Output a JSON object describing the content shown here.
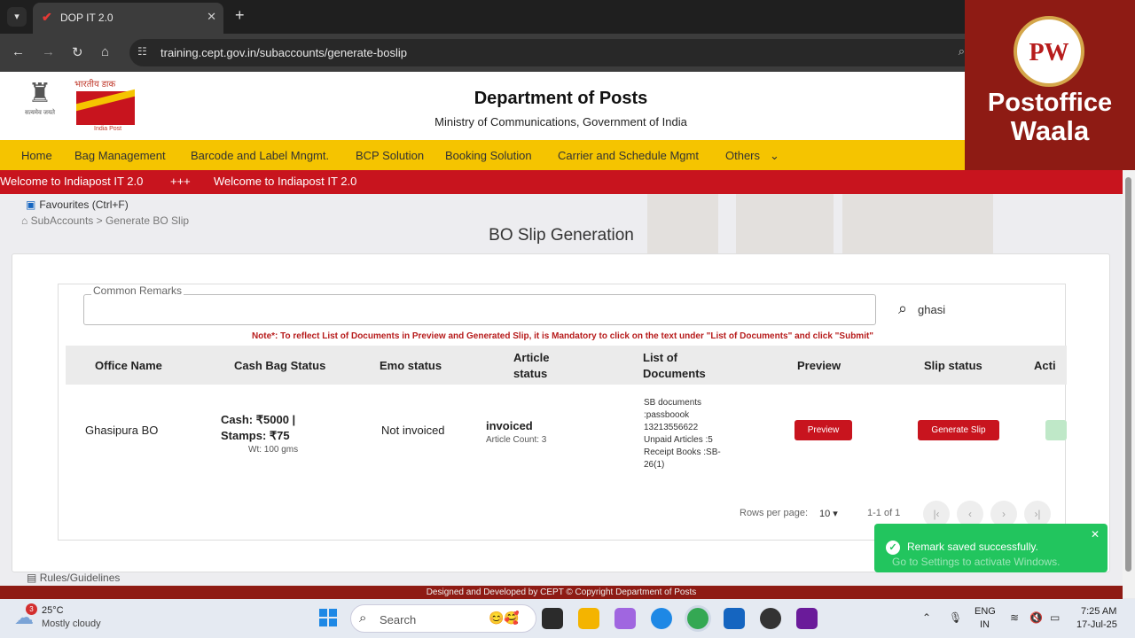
{
  "browser": {
    "tab_title": "DOP IT 2.0",
    "url": "training.cept.gov.in/subaccounts/generate-boslip"
  },
  "overlay": {
    "logo_text": "PW",
    "line1": "Postoffice",
    "line2": "Waala"
  },
  "header": {
    "title": "Department of Posts",
    "subtitle": "Ministry of Communications, Government of India",
    "emblem_caption": "सत्यमेव जयते",
    "logo_hindi": "भारतीय डाक",
    "logo_english": "India Post"
  },
  "nav": {
    "items": [
      "Home",
      "Bag Management",
      "Barcode and Label Mngmt.",
      "BCP Solution",
      "Booking Solution",
      "Carrier and Schedule Mgmt",
      "Others"
    ]
  },
  "ticker": {
    "msg1": "Welcome to Indiapost IT 2.0",
    "sep": "+++",
    "msg2": "Welcome to Indiapost IT 2.0"
  },
  "page": {
    "favourites": "Favourites (Ctrl+F)",
    "breadcrumb_root": "SubAccounts",
    "breadcrumb_sep": ">",
    "breadcrumb_current": "Generate BO Slip",
    "title": "BO Slip Generation",
    "remarks_label": "Common Remarks",
    "remarks_value": "",
    "search_value": "ghasi",
    "note": "Note*: To reflect List of Documents in Preview and Generated Slip, it is Mandatory to click on the text under \"List of Documents\" and click \"Submit\""
  },
  "table": {
    "headers": {
      "office": "Office Name",
      "cash": "Cash Bag Status",
      "emo": "Emo status",
      "article1": "Article",
      "article2": "status",
      "docs1": "List of",
      "docs2": "Documents",
      "preview": "Preview",
      "slip": "Slip status",
      "action": "Acti"
    },
    "row": {
      "office": "Ghasipura BO",
      "cash_line1": "Cash: ₹5000 |",
      "cash_line2": "Stamps: ₹75",
      "weight": "Wt: 100 gms",
      "emo": "Not invoiced",
      "article_status": "invoiced",
      "article_count": "Article Count: 3",
      "docs": [
        "SB documents",
        ":passboook",
        "13213556622",
        "Unpaid Articles :5",
        "Receipt Books :SB-",
        "26(1)"
      ],
      "preview_btn": "Preview",
      "slip_btn": "Generate Slip"
    }
  },
  "pager": {
    "rows_label": "Rows per page:",
    "rows_value": "10",
    "range": "1-1 of 1"
  },
  "rules": "Rules/Guidelines",
  "footer": "Designed and Developed by CEPT © Copyright Department of Posts",
  "toast": {
    "message": "Remark saved successfully.",
    "watermark": "Go to Settings to activate Windows."
  },
  "taskbar": {
    "weather_badge": "3",
    "temperature": "25°C",
    "weather_desc": "Mostly cloudy",
    "search_label": "Search",
    "lang1": "ENG",
    "lang2": "IN",
    "time": "7:25 AM",
    "date": "17-Jul-25"
  },
  "colors": {
    "nav_yellow": "#f5c400",
    "ticker_red": "#c8141e",
    "button_red": "#c8141e",
    "toast_green": "#22c55e",
    "footer_maroon": "#8e1b14"
  }
}
